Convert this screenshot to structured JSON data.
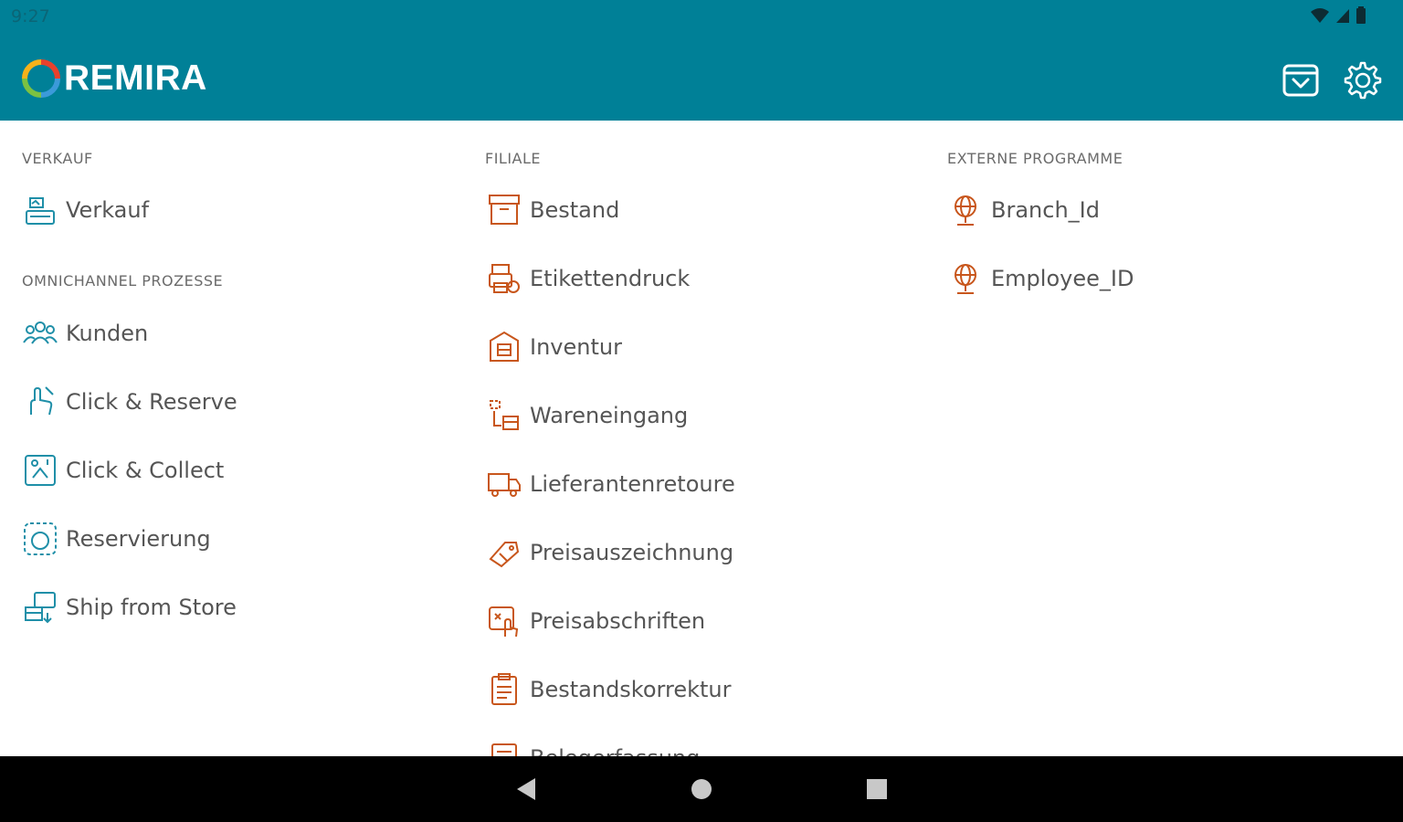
{
  "status_bar": {
    "time": "9:27"
  },
  "app_bar": {
    "brand": "REMIRA",
    "icons": [
      "cart-icon",
      "settings-icon"
    ]
  },
  "columns": {
    "left": {
      "sections": [
        {
          "header": "VERKAUF",
          "items": [
            {
              "label": "Verkauf",
              "icon": "cash-register-icon"
            }
          ]
        },
        {
          "header": "OMNICHANNEL PROZESSE",
          "items": [
            {
              "label": "Kunden",
              "icon": "customers-icon"
            },
            {
              "label": "Click & Reserve",
              "icon": "click-reserve-icon"
            },
            {
              "label": "Click & Collect",
              "icon": "click-collect-icon"
            },
            {
              "label": "Reservierung",
              "icon": "reservation-icon"
            },
            {
              "label": "Ship from Store",
              "icon": "ship-from-store-icon"
            }
          ]
        }
      ]
    },
    "middle": {
      "header": "FILIALE",
      "items": [
        {
          "label": "Bestand",
          "icon": "archive-box-icon"
        },
        {
          "label": "Etikettendruck",
          "icon": "label-print-icon"
        },
        {
          "label": "Inventur",
          "icon": "inventory-icon"
        },
        {
          "label": "Wareneingang",
          "icon": "goods-receipt-icon"
        },
        {
          "label": "Lieferantenretoure",
          "icon": "truck-icon"
        },
        {
          "label": "Preisauszeichnung",
          "icon": "price-tag-icon"
        },
        {
          "label": "Preisabschriften",
          "icon": "price-markdown-icon"
        },
        {
          "label": "Bestandskorrektur",
          "icon": "clipboard-icon"
        },
        {
          "label": "Belegerfassung",
          "icon": "document-icon"
        }
      ]
    },
    "right": {
      "header": "EXTERNE PROGRAMME",
      "items": [
        {
          "label": "Branch_Id",
          "icon": "globe-pin-icon"
        },
        {
          "label": "Employee_ID",
          "icon": "globe-pin-icon"
        }
      ]
    }
  },
  "colors": {
    "app_bar": "#008097",
    "teal_icon": "#1f8fa8",
    "orange_icon": "#c8561c",
    "text": "#555555",
    "header_text": "#6b6b6b"
  },
  "nav_bar": {
    "buttons": [
      "back-icon",
      "home-icon",
      "recents-icon"
    ]
  }
}
